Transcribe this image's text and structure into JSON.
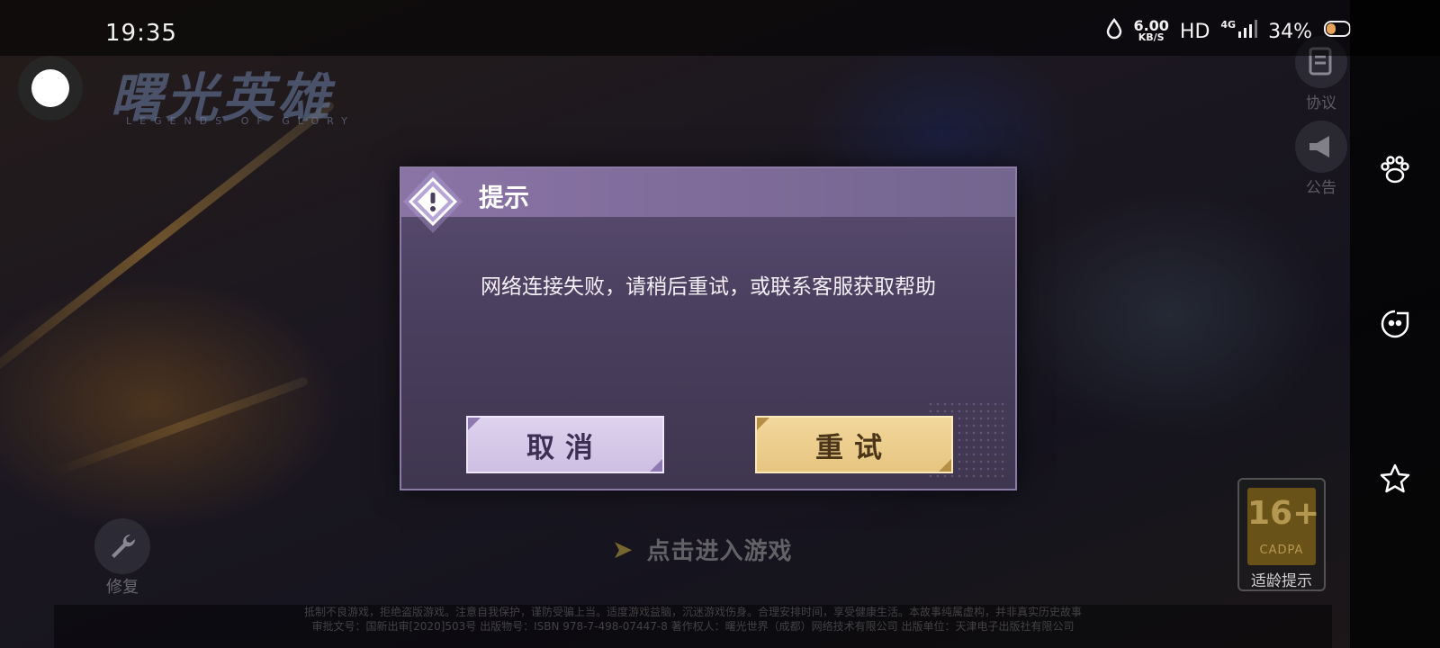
{
  "status_bar": {
    "time": "19:35",
    "speed_value": "6.00",
    "speed_unit": "KB/S",
    "hd": "HD",
    "network": "4G",
    "battery": "34%"
  },
  "game": {
    "logo_title": "曙光英雄",
    "logo_subtitle": "LEGENDS OF GLORY",
    "agreement_label": "协议",
    "announcement_label": "公告",
    "repair_label": "修复",
    "enter_game": "点击进入游戏",
    "age_rating": {
      "number": "16+",
      "org": "CADPA",
      "label": "适龄提示"
    },
    "footer_line1": "抵制不良游戏，拒绝盗版游戏。注意自我保护，谨防受骗上当。适度游戏益脑，沉迷游戏伤身。合理安排时间，享受健康生活。本故事纯属虚构，并非真实历史故事",
    "footer_line2": "审批文号：国新出审[2020]503号 出版物号：ISBN 978-7-498-07447-8 著作权人：曙光世界（成都）网络技术有限公司 出版单位：天津电子出版社有限公司"
  },
  "dialog": {
    "title": "提示",
    "message": "网络连接失败，请稍后重试，或联系客服获取帮助",
    "cancel_label": "取消",
    "retry_label": "重试"
  },
  "colors": {
    "dialog_bg": "#4a3f5e",
    "dialog_header": "#8a74a6",
    "cancel_button": "#ddd2ee",
    "retry_button": "#f2d79c"
  },
  "icons": {
    "right_bar": [
      "paw-icon",
      "face-icon",
      "star-icon"
    ],
    "dialog_badge": "warning-icon"
  }
}
